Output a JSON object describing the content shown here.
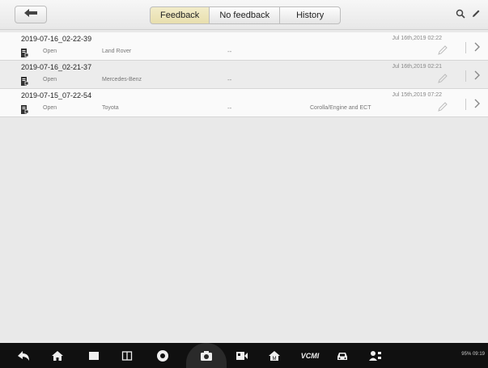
{
  "header": {
    "tabs": [
      {
        "label": "Feedback",
        "active": true
      },
      {
        "label": "No feedback",
        "active": false
      },
      {
        "label": "History",
        "active": false
      }
    ],
    "back_icon": "back-arrow-icon",
    "search_icon": "search-icon",
    "edit_icon": "pencil-icon"
  },
  "records": [
    {
      "title": "2019-07-16_02-22-39",
      "status": "Open",
      "make": "Land Rover",
      "dash": "--",
      "extra": "",
      "date": "Jul 16th,2019 02:22"
    },
    {
      "title": "2019-07-16_02-21-37",
      "status": "Open",
      "make": "Mercedes-Benz",
      "dash": "--",
      "extra": "",
      "date": "Jul 16th,2019 02:21"
    },
    {
      "title": "2019-07-15_07-22-54",
      "status": "Open",
      "make": "Toyota",
      "dash": "--",
      "extra": "Corolla/Engine and ECT",
      "date": "Jul 15th,2019 07:22"
    }
  ],
  "navbar": {
    "icons": [
      "back-icon",
      "home-icon",
      "recent-apps-icon",
      "split-screen-icon",
      "chrome-icon",
      "camera-icon",
      "screen-record-icon",
      "home-garage-icon",
      "vcmi-icon",
      "car-icon",
      "user-network-icon"
    ],
    "vcmi_label": "VCMI",
    "status_text": "95% 09:19"
  },
  "colors": {
    "active_tab": "#efe7bd",
    "background": "#e9e9e9",
    "navbar": "#101010"
  }
}
